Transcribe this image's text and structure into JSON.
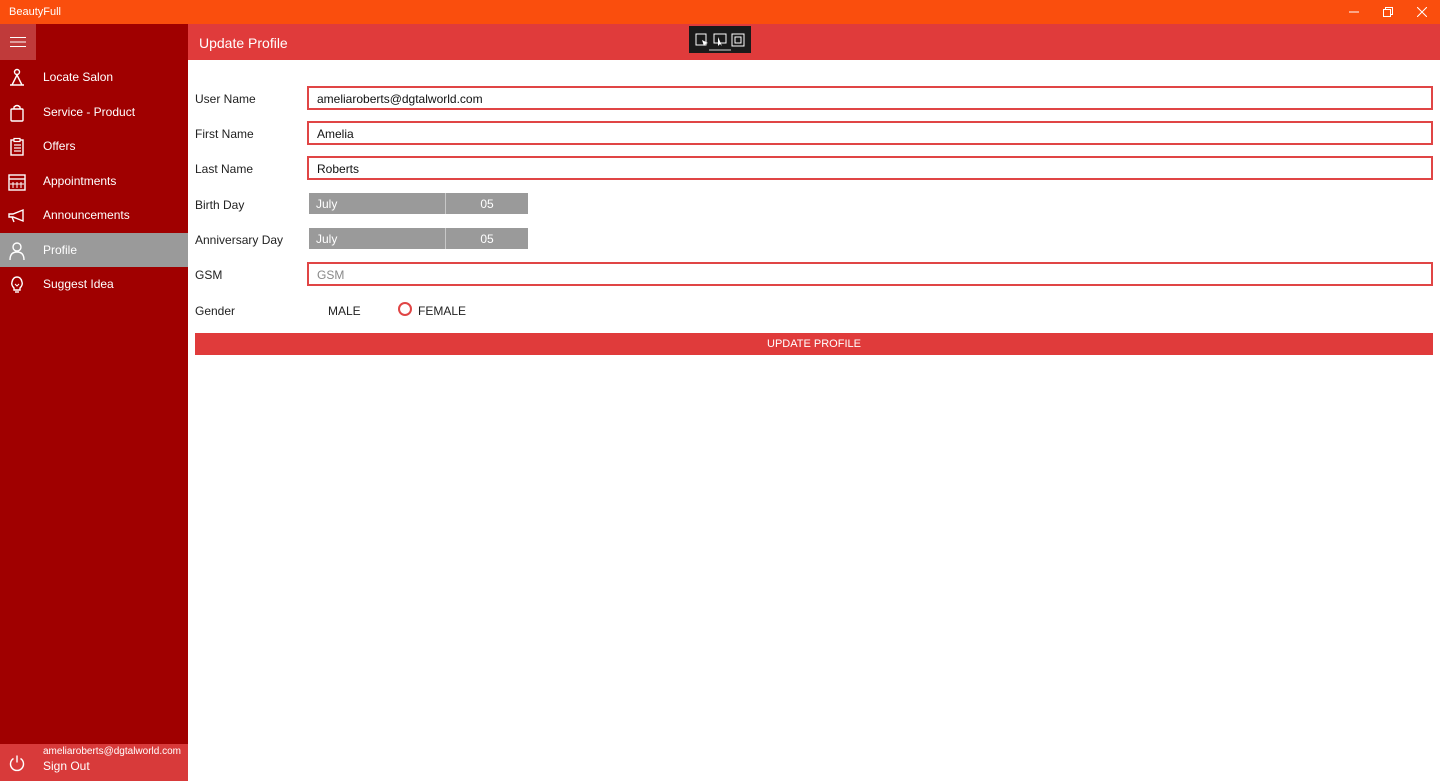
{
  "window": {
    "title": "BeautyFull",
    "title_bar_color": "#fa4e0d"
  },
  "sidebar": {
    "background": "#a00000",
    "menu_icon": "hamburger-icon",
    "items": [
      {
        "label": "Locate Salon",
        "icon": "location-pin-icon",
        "active": false
      },
      {
        "label": "Service - Product",
        "icon": "shopping-bag-icon",
        "active": false
      },
      {
        "label": "Offers",
        "icon": "clipboard-list-icon",
        "active": false
      },
      {
        "label": "Appointments",
        "icon": "calendar-icon",
        "active": false
      },
      {
        "label": "Announcements",
        "icon": "megaphone-icon",
        "active": false
      },
      {
        "label": "Profile",
        "icon": "person-icon",
        "active": true
      },
      {
        "label": "Suggest Idea",
        "icon": "lightbulb-icon",
        "active": false
      }
    ],
    "footer": {
      "email": "ameliaroberts@dgtalworld.com",
      "sign_out_label": "Sign Out",
      "icon": "power-icon"
    }
  },
  "header": {
    "title": "Update Profile",
    "accent": "#e03b3b"
  },
  "form": {
    "username": {
      "label": "User Name",
      "value": "ameliaroberts@dgtalworld.com"
    },
    "first_name": {
      "label": "First Name",
      "value": "Amelia"
    },
    "last_name": {
      "label": "Last Name",
      "value": "Roberts"
    },
    "birthday": {
      "label": "Birth Day",
      "month": "July",
      "day": "05"
    },
    "anniversary": {
      "label": "Anniversary Day",
      "month": "July",
      "day": "05"
    },
    "gsm": {
      "label": "GSM",
      "placeholder": "GSM",
      "value": ""
    },
    "gender": {
      "label": "Gender",
      "options": [
        "MALE",
        "FEMALE"
      ]
    },
    "submit_label": "UPDATE PROFILE"
  }
}
